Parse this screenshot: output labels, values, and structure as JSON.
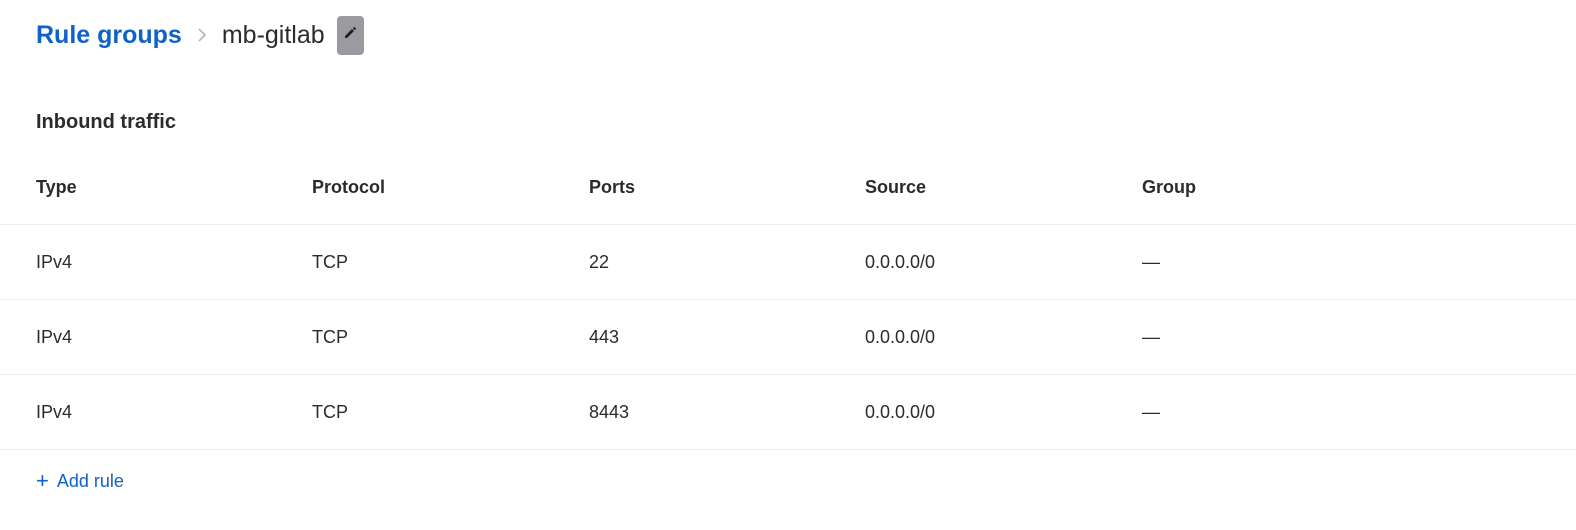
{
  "breadcrumb": {
    "parent_label": "Rule groups",
    "current_label": "mb-gitlab"
  },
  "section": {
    "title": "Inbound traffic"
  },
  "table": {
    "columns": [
      "Type",
      "Protocol",
      "Ports",
      "Source",
      "Group"
    ],
    "rows": [
      {
        "type": "IPv4",
        "protocol": "TCP",
        "ports": "22",
        "source": "0.0.0.0/0",
        "group": "—"
      },
      {
        "type": "IPv4",
        "protocol": "TCP",
        "ports": "443",
        "source": "0.0.0.0/0",
        "group": "—"
      },
      {
        "type": "IPv4",
        "protocol": "TCP",
        "ports": "8443",
        "source": "0.0.0.0/0",
        "group": "—"
      }
    ]
  },
  "actions": {
    "add_rule_icon": "+",
    "add_rule_label": "Add rule"
  },
  "colors": {
    "accent": "#0f62c9",
    "edit_button": "#9b9aa1"
  },
  "icons": {
    "separator": "chevron-right-icon",
    "edit": "pencil-icon",
    "add": "plus-icon"
  }
}
